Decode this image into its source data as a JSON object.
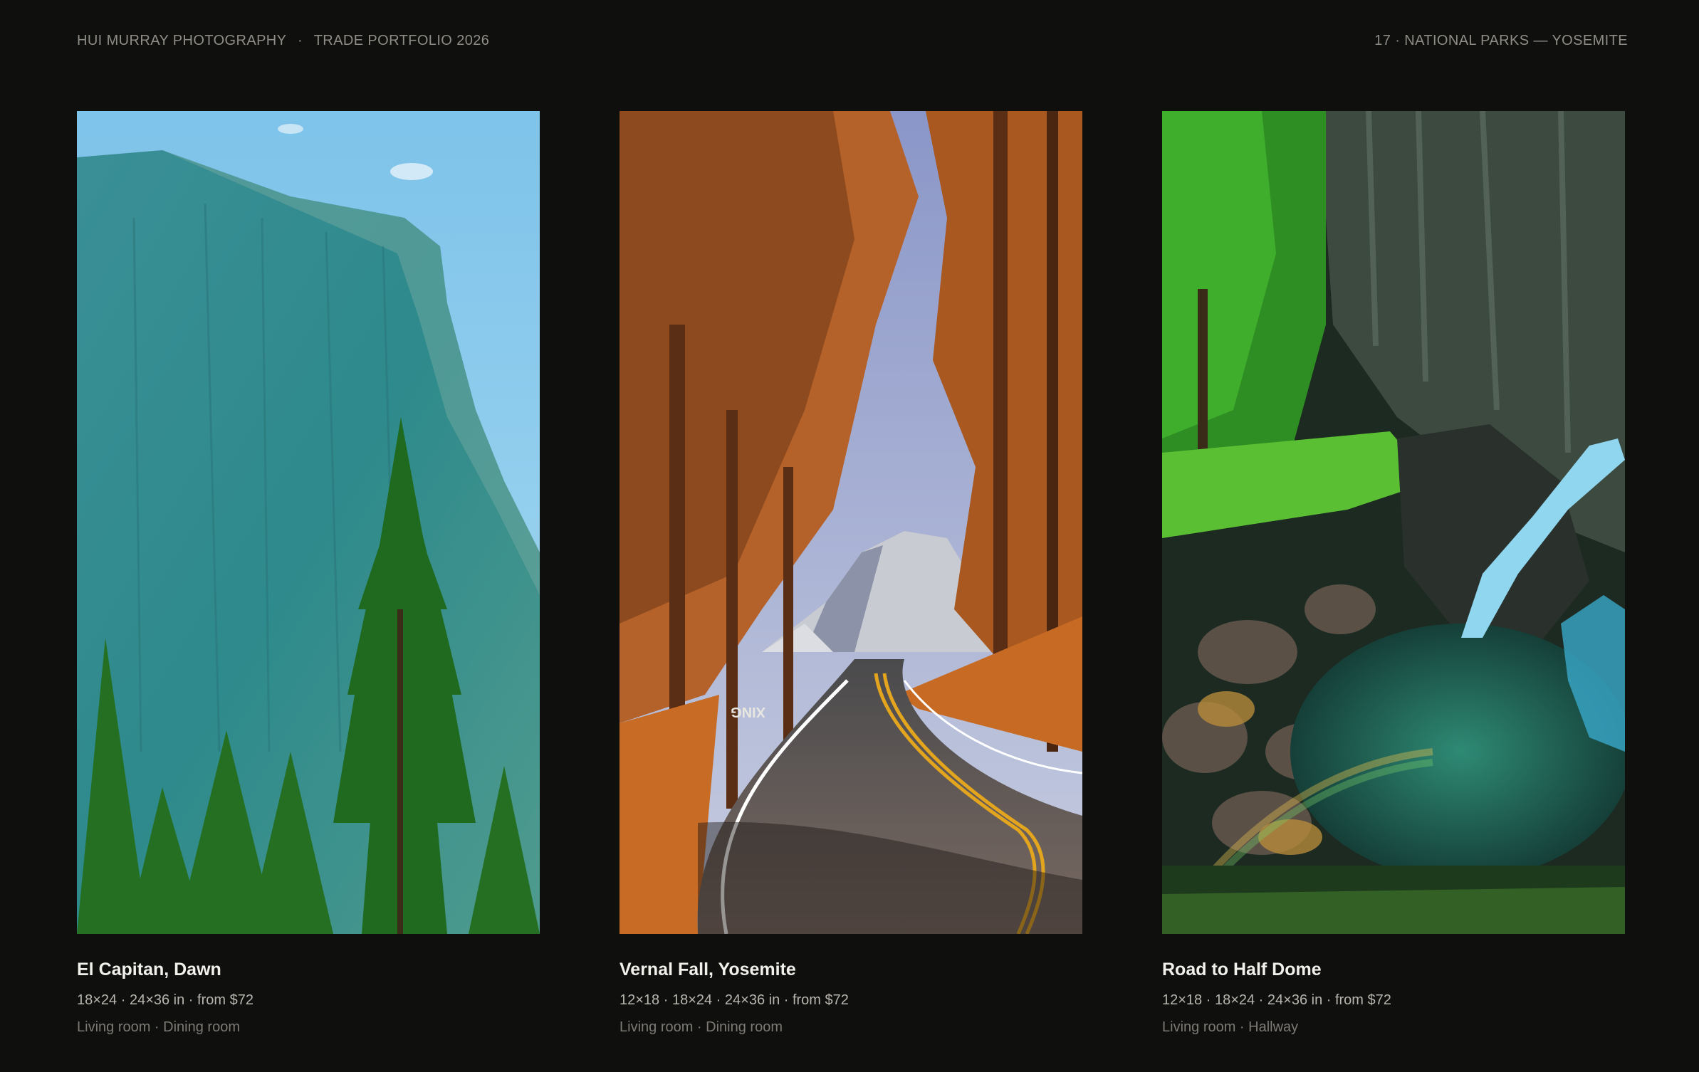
{
  "header": {
    "brand": "HUI MURRAY PHOTOGRAPHY",
    "separator": "·",
    "portfolio": "TRADE PORTFOLIO 2026",
    "section": "17 · NATIONAL PARKS — YOSEMITE"
  },
  "cards": [
    {
      "title": "El Capitan, Dawn",
      "specs": "18×24 · 24×36 in  ·  from $72",
      "rooms": "Living room · Dining room",
      "image": "el-capitan-cliff-photo"
    },
    {
      "title": "Vernal Fall, Yosemite",
      "specs": "12×18 · 18×24 · 24×36 in  ·  from $72",
      "rooms": "Living room · Dining room",
      "image": "half-dome-road-photo",
      "road_marking": "XING"
    },
    {
      "title": "Road to Half Dome",
      "specs": "12×18 · 18×24 · 24×36 in  ·  from $72",
      "rooms": "Living room · Hallway",
      "image": "vernal-fall-waterfall-photo"
    }
  ],
  "colors": {
    "background": "#0f0f0e",
    "header_text": "#8f8c86",
    "title_text": "#f2f0eb",
    "specs_text": "#b8b5ae",
    "rooms_text": "#7d7a74"
  }
}
